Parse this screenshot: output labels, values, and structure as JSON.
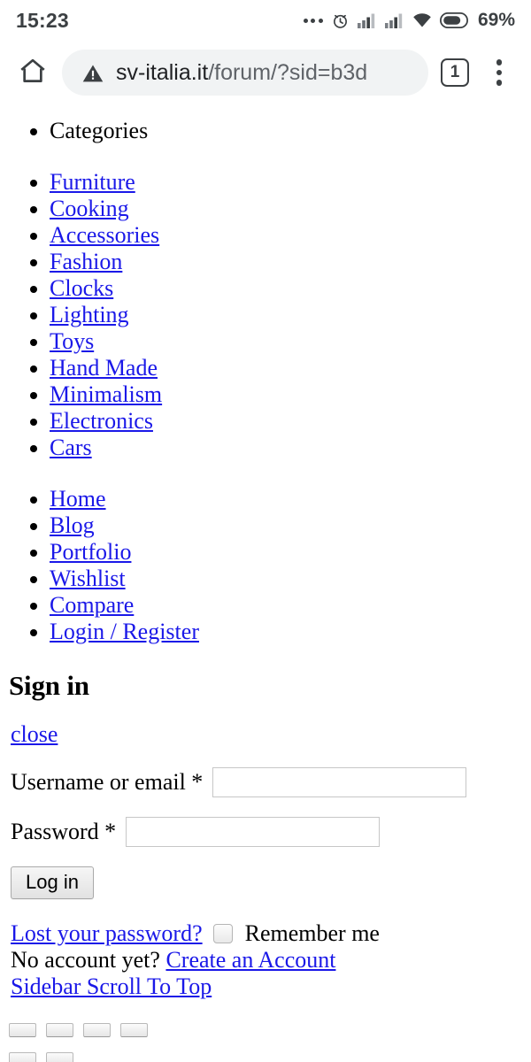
{
  "status_bar": {
    "time": "15:23",
    "battery_percent": "69%",
    "icons": [
      "more-dots-icon",
      "alarm-icon",
      "signal-icon",
      "signal-icon",
      "wifi-icon",
      "battery-icon"
    ]
  },
  "toolbar": {
    "home_icon": "home-icon",
    "security_icon": "warning-triangle-icon",
    "url_host": "sv-italia.it",
    "url_path": "/forum/?sid=b3d",
    "tab_count": "1",
    "menu_icon": "overflow-menu-icon"
  },
  "page": {
    "categories_heading": "Categories",
    "categories": [
      "Furniture",
      "Cooking",
      "Accessories",
      "Fashion",
      "Clocks",
      "Lighting",
      "Toys",
      "Hand Made",
      "Minimalism",
      "Electronics",
      "Cars"
    ],
    "pages": [
      "Home",
      "Blog",
      "Portfolio",
      "Wishlist",
      "Compare",
      "Login / Register"
    ],
    "sign_in": {
      "title": "Sign in",
      "close_label": "close",
      "username_label": "Username or email *",
      "username_value": "",
      "password_label": "Password *",
      "password_value": "",
      "login_button": "Log in",
      "lost_password_label": "Lost your password?",
      "remember_me_label": "Remember me",
      "remember_me_checked": false,
      "no_account_text": "No account yet?",
      "create_account_label": "Create an Account",
      "sidebar_scroll_label": "Sidebar Scroll To Top"
    },
    "stub_rows": [
      4,
      2
    ]
  },
  "colors": {
    "link": "#1a18e8",
    "text": "#000000",
    "omnibox_bg": "#f1f3f4",
    "url_host": "#202124",
    "url_path": "#5f6368"
  }
}
